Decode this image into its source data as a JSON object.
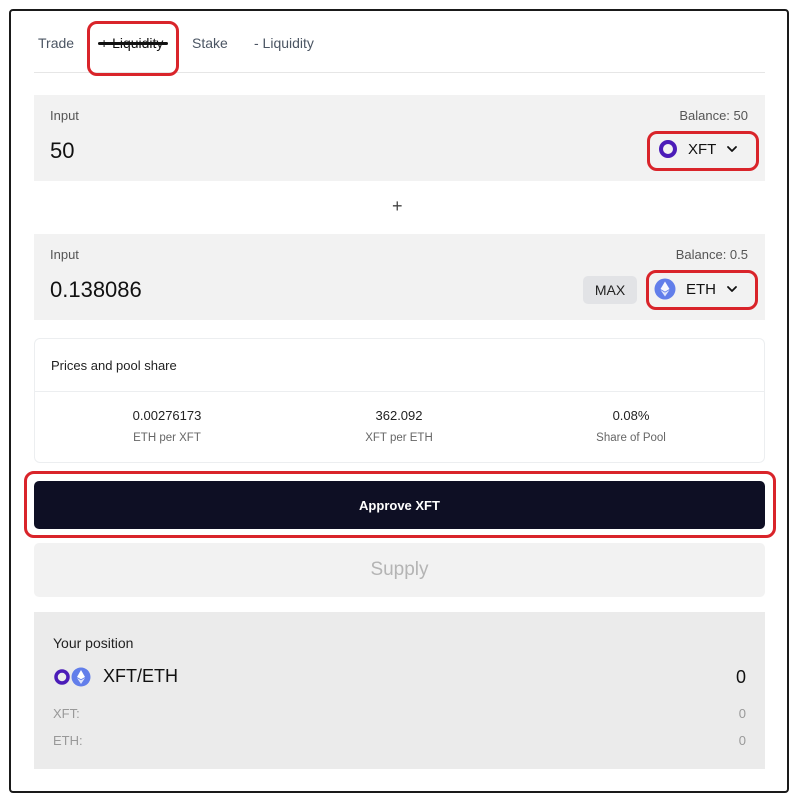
{
  "tabs": [
    {
      "label": "Trade"
    },
    {
      "label": "+ Liquidity",
      "active": true
    },
    {
      "label": "Stake"
    },
    {
      "label": "- Liquidity"
    }
  ],
  "input_a": {
    "label": "Input",
    "balance": "Balance: 50",
    "amount": "50",
    "token": "XFT"
  },
  "plus_sign": "+",
  "input_b": {
    "label": "Input",
    "balance": "Balance: 0.5",
    "amount": "0.138086",
    "max_label": "MAX",
    "token": "ETH"
  },
  "prices": {
    "title": "Prices and pool share",
    "stats": [
      {
        "value": "0.00276173",
        "caption": "ETH per XFT"
      },
      {
        "value": "362.092",
        "caption": "XFT per ETH"
      },
      {
        "value": "0.08%",
        "caption": "Share of Pool"
      }
    ]
  },
  "approve_label": "Approve XFT",
  "supply_label": "Supply",
  "position": {
    "title": "Your position",
    "pair": "XFT/ETH",
    "pair_value": "0",
    "rows": [
      {
        "label": "XFT:",
        "value": "0"
      },
      {
        "label": "ETH:",
        "value": "0"
      }
    ]
  },
  "colors": {
    "accent_dark": "#0e0f24",
    "highlight": "#d9242a",
    "xft_purple": "#4b1cb8",
    "eth_blue": "#627eea"
  },
  "icons": {
    "xft": "xft-token-icon",
    "eth": "eth-token-icon",
    "chevron": "chevron-down-icon"
  }
}
